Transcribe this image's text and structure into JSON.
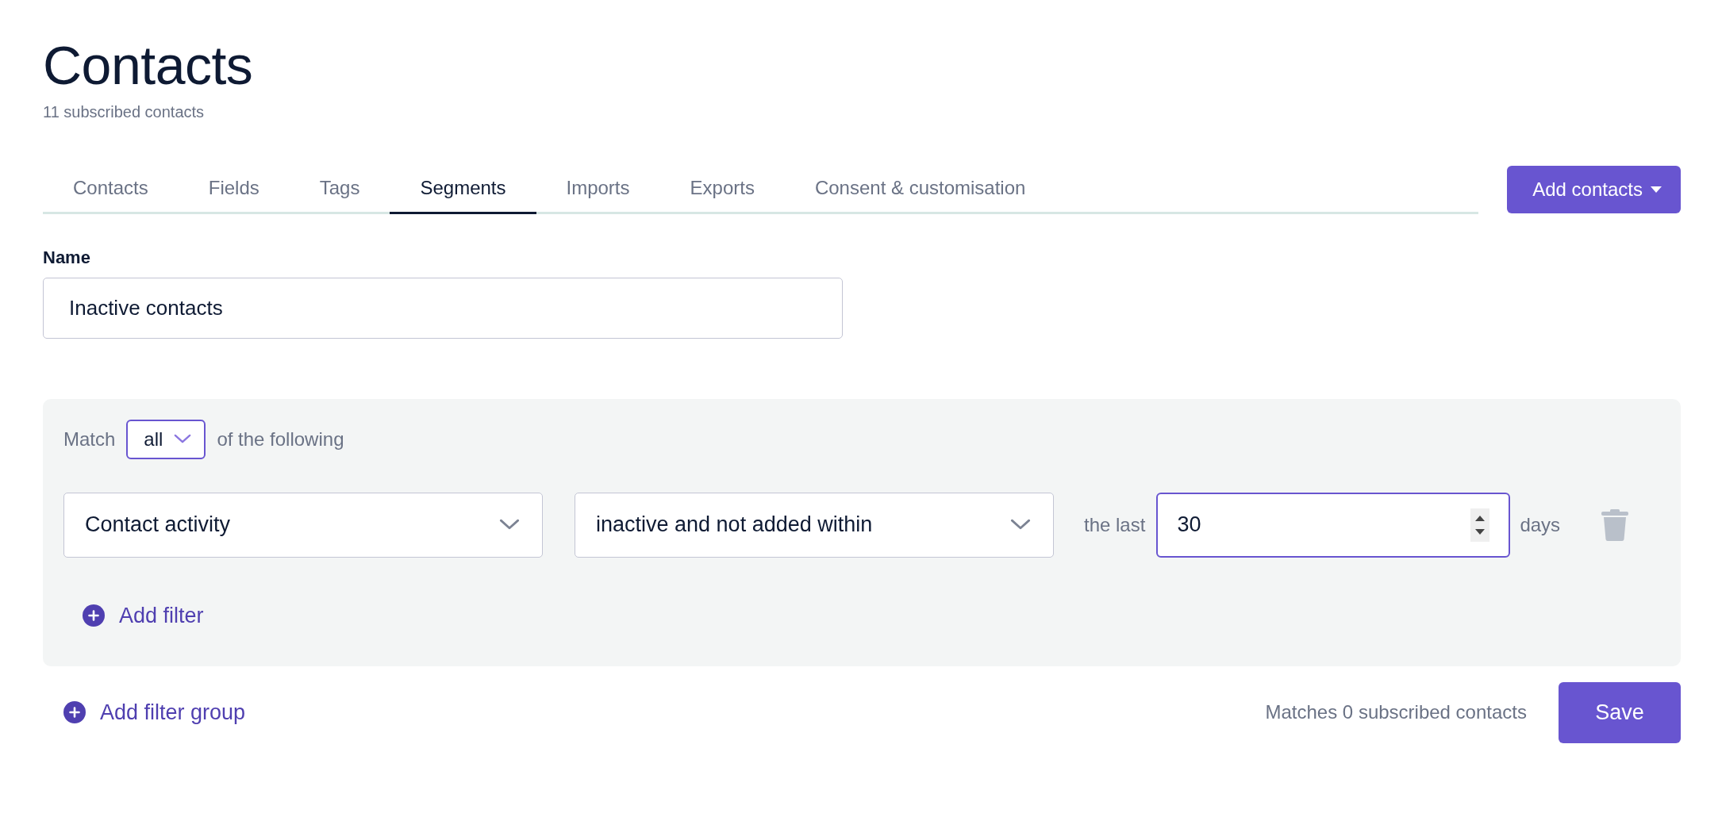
{
  "page": {
    "title": "Contacts",
    "subtitle": "11 subscribed contacts"
  },
  "tabs": [
    {
      "label": "Contacts",
      "selected": false
    },
    {
      "label": "Fields",
      "selected": false
    },
    {
      "label": "Tags",
      "selected": false
    },
    {
      "label": "Segments",
      "selected": true
    },
    {
      "label": "Imports",
      "selected": false
    },
    {
      "label": "Exports",
      "selected": false
    },
    {
      "label": "Consent & customisation",
      "selected": false
    }
  ],
  "add_contacts_button": {
    "label": "Add contacts"
  },
  "name_field": {
    "label": "Name",
    "value": "Inactive contacts"
  },
  "filter_group": {
    "match_label": "Match",
    "match_value": "all",
    "match_suffix": "of the following",
    "filters": [
      {
        "field": "Contact activity",
        "condition": "inactive and not added within",
        "prefix": "the last",
        "value": "30",
        "suffix": "days"
      }
    ],
    "add_filter": "Add filter"
  },
  "add_filter_group": "Add filter group",
  "match_count": "Matches 0 subscribed contacts",
  "save_button": "Save"
}
